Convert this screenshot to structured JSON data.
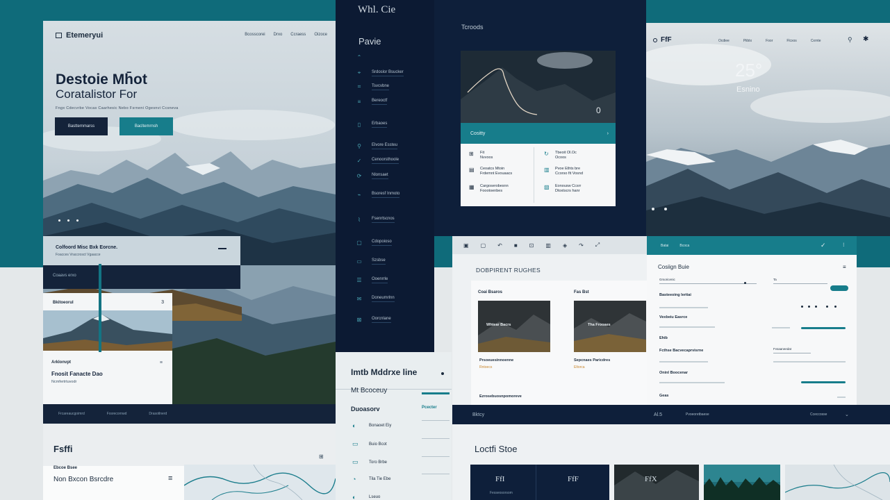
{
  "landing": {
    "brand": "Etemeryui",
    "nav": [
      "Bcosscorei",
      "Drxo",
      "Ccraess",
      "Oizoce"
    ],
    "title_line1": "Destoie Mh̄ot",
    "title_line2": "Coratalistor For",
    "subtitle": "Fngx Cdecvrbe  Vocas  Caarhesic Nebo  Fsrneni  Ogesnvi  Ccsneva",
    "btn_primary": "Basttemmarss",
    "btn_secondary": "Bacltemrnsh",
    "strip_title": "Colfoord Misc Bxk Eorcne.",
    "strip_sub": "Foacces  Vraccrosct  Vgaacce",
    "band_label": "Coaavs erxo",
    "card_header": "Bkitoeorul",
    "card_number": "3",
    "card_label1": "Arklonvpt",
    "card_title": "Fnosit Fanacte Dao",
    "card_sub": "Ncmfertrtuvodr",
    "footer": [
      "Frcareaucgoimrd",
      "Fxsrecornwd",
      "Drasotlnerd"
    ]
  },
  "sidebar": {
    "title": "Whl. Cie",
    "subtitle": "Pavie",
    "items": [
      {
        "icon": "sparkle-icon",
        "glyph": "⌃",
        "label": ""
      },
      {
        "icon": "pin-icon",
        "glyph": "⌖",
        "label": "Srdoslor Bsucker"
      },
      {
        "icon": "tag-icon",
        "glyph": "⌗",
        "label": "Tsvcvbne"
      },
      {
        "icon": "doc-icon",
        "glyph": "≡",
        "label": "Bereoctf"
      },
      {
        "icon": "file-icon",
        "glyph": "▯",
        "label": "Erbaoes"
      },
      {
        "icon": "chart-icon",
        "glyph": "⚲",
        "label": "Elvore Essteu"
      },
      {
        "icon": "check-icon",
        "glyph": "✓",
        "label": "Cenoorsthoole"
      },
      {
        "icon": "globe-icon",
        "glyph": "⟳",
        "label": "Nlonsaet"
      },
      {
        "icon": "link-icon",
        "glyph": "⌁",
        "label": "Bsoresf Inmoto"
      },
      {
        "icon": "brush-icon",
        "glyph": "⌇",
        "label": "Fsenrtscnos"
      },
      {
        "icon": "folder-icon",
        "glyph": "▢",
        "label": "Cdopoioso"
      },
      {
        "icon": "sheet-icon",
        "glyph": "▭",
        "label": "Szsbse"
      },
      {
        "icon": "list-icon",
        "glyph": "☰",
        "label": "Ooenrrle"
      },
      {
        "icon": "mail-icon",
        "glyph": "✉",
        "label": "Doneumrlnn"
      },
      {
        "icon": "box-icon",
        "glyph": "⊠",
        "label": "Oorcnlane"
      }
    ]
  },
  "mobile": {
    "title": "Imtb Mddrxe line",
    "subtitle": "Mt Bcoceuy",
    "section": "Duoasorv",
    "section_right": "Pcecter",
    "items": [
      "Bonaoet Eiy",
      "Buio Bcot",
      "Toro Brbe",
      "Tila Tie Ebe",
      "Lseuo"
    ]
  },
  "dashboard": {
    "label": "Tcroods",
    "zero": "0",
    "bar_label": "Cositty",
    "bar_arrow": "›",
    "cells": [
      {
        "title": "Fit",
        "sub": "Nvvoos"
      },
      {
        "title": "Tbeoit Ol.Oc",
        "sub": "Ocoos"
      },
      {
        "title": "Ceoatcs Mtoin",
        "sub": "Frdemnt Evouaacs"
      },
      {
        "title": "Pvoe Ethts bre",
        "sub": "Ccorso fit Vosnd"
      },
      {
        "title": "Cargoserobesnn",
        "sub": "Foootoenbes"
      },
      {
        "title": "Eonousw Ccsrr",
        "sub": "Dtoxtscrs hanr"
      }
    ]
  },
  "weather": {
    "brand": "FfF",
    "nav": [
      "Ocdiee",
      "Piibtx",
      "Foor",
      "Flcxos",
      "Cxrnte"
    ],
    "temperature": "25°",
    "city": "Esnino"
  },
  "documents": {
    "title": "DOBPIRENT RUGHES",
    "col1": "Coai Bsaros",
    "col2": "Fas Bst",
    "cap1": "Whtear Bacrs",
    "cap2": "Tha Frooaes",
    "text1": "Prsoeuesinnoenne",
    "sub1": "Rntoecs",
    "text2": "Sepcnaes Paricdres",
    "sub2": "Eltorca",
    "bottom": "Ezrosebuosnpomoreve"
  },
  "settings": {
    "tabs": [
      "Batai",
      "Bcoca"
    ],
    "title": "Cosiign Buie",
    "labels": [
      "Basteeoing Ieritai",
      "Vexbeiu Easrce",
      "Ehib",
      "Fcthse Bacvecaprvisrne",
      "Oninl Boocenar"
    ],
    "field_values": [
      "Grsoricenic",
      "Ta",
      "Fvsaaneedat"
    ],
    "bottom": "Geas"
  },
  "band": {
    "left": "Bktcy",
    "mid": "Al.5",
    "mid2": "Pvoeoretbaese",
    "right": "Cceccosse",
    "right_icon": "⌄"
  },
  "map_panel": {
    "title": "Fsffi",
    "card_label": "Ebcoe Bsee",
    "card_title": "Non Bxcon Bsrcdre"
  },
  "stories": {
    "title": "Loctfi Stoe",
    "tiles": [
      {
        "label": "FfI",
        "sub": "Fesseosorsom"
      },
      {
        "label": "FfF",
        "sub": ""
      },
      {
        "label": "FfX",
        "sub": ""
      }
    ]
  },
  "colors": {
    "navy": "#0e1f3a",
    "teal": "#177d8b",
    "background_teal": "#0f6b7a"
  }
}
